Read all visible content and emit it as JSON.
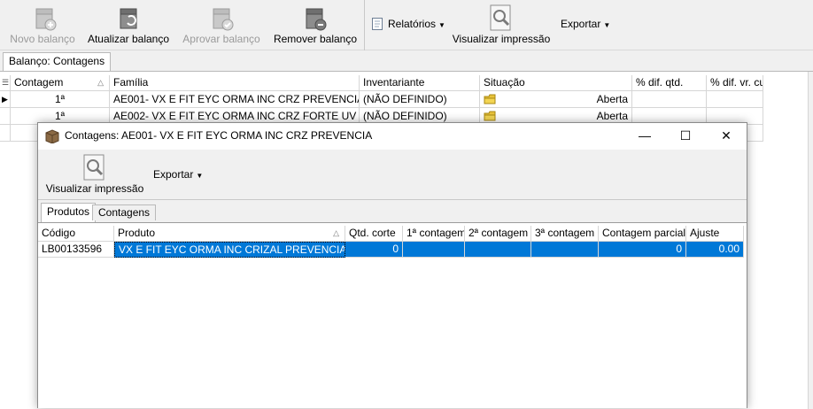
{
  "toolbar": {
    "novo_balanco": "Novo balanço",
    "atualizar_balanco": "Atualizar balanço",
    "aprovar_balanco": "Aprovar balanço",
    "remover_balanco": "Remover balanço",
    "relatorios": "Relatórios",
    "visualizar_impressao": "Visualizar impressão",
    "exportar": "Exportar"
  },
  "main_tab": {
    "label": "Balanço: Contagens"
  },
  "main_grid": {
    "columns": [
      "Contagem",
      "Família",
      "Inventariante",
      "Situação",
      "% dif. qtd.",
      "% dif. vr. cu"
    ],
    "rows": [
      {
        "contagem": "1ª",
        "familia": "AE001- VX E FIT EYC ORMA INC CRZ PREVENCIA",
        "inventariante": "(NÃO DEFINIDO)",
        "situacao": "Aberta",
        "dif_qtd": "",
        "dif_vr": ""
      },
      {
        "contagem": "1ª",
        "familia": "AE002- VX E FIT EYC ORMA INC CRZ FORTE UV",
        "inventariante": "(NÃO DEFINIDO)",
        "situacao": "Aberta",
        "dif_qtd": "",
        "dif_vr": ""
      }
    ]
  },
  "dialog": {
    "title": "Contagens: AE001- VX E FIT EYC ORMA INC CRZ PREVENCIA",
    "toolbar": {
      "visualizar_impressao": "Visualizar impressão",
      "exportar": "Exportar"
    },
    "tabs": [
      "Produtos",
      "Contagens"
    ],
    "grid": {
      "columns": [
        "Código",
        "Produto",
        "Qtd. corte",
        "1ª contagem",
        "2ª contagem",
        "3ª contagem",
        "Contagem parcial",
        "Ajuste"
      ],
      "rows": [
        {
          "codigo": "LB00133596",
          "produto": "VX E FIT EYC ORMA INC CRIZAL PREVENCIA",
          "qtd_corte": "0",
          "c1": "",
          "c2": "",
          "c3": "",
          "parcial": "0",
          "ajuste": "0.00"
        }
      ]
    }
  },
  "icons": {
    "new": "box-plus-icon",
    "refresh": "box-refresh-icon",
    "approve": "box-check-icon",
    "remove": "box-minus-icon",
    "report": "document-icon",
    "preview": "magnifier-icon",
    "status": "folder-icon",
    "window": "box-icon"
  },
  "colors": {
    "selection": "#0078d7",
    "toolbar_bg": "#f0f0f0"
  }
}
